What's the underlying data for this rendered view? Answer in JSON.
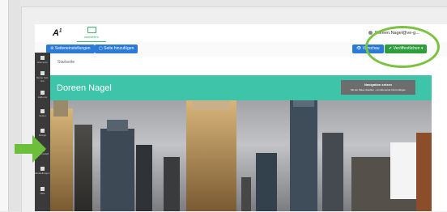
{
  "app": {
    "logo_text": "A",
    "logo_sup": "1",
    "top_nav_label": "webseiten",
    "user_name": "Doreen.Nagel@ve-g..."
  },
  "toolbar": {
    "settings_label": "⚙ Seiteneinstellungen",
    "add_page_label": "▢ Seite hinzufügen",
    "preview_label": "👁 Vorschau",
    "publish_label": "✔ Veröffentlichen ▾"
  },
  "breadcrumb": "Startseite",
  "sidebar": {
    "items": [
      {
        "label": "Elemente",
        "icon": "grid-icon"
      },
      {
        "label": "Meine Sek- tion",
        "icon": "plus-icon"
      },
      {
        "label": "Add-ons",
        "icon": "puzzle-icon"
      },
      {
        "label": "Seiten",
        "icon": "pages-icon"
      },
      {
        "label": "Design",
        "icon": "monitor-icon"
      },
      {
        "label": "Farbmodell",
        "icon": "drop-icon"
      },
      {
        "label": "Einstellungen",
        "icon": "gear-icon"
      },
      {
        "label": "Hilfe",
        "icon": "help-icon"
      }
    ]
  },
  "hero": {
    "title": "Doreen Nagel",
    "nav_box_title": "Navigation setzen",
    "nav_box_subtitle": "Mit der Maus drauflen - um Elemente hinzuzufügen"
  },
  "colors": {
    "accent_teal": "#3ec4a8",
    "primary_blue": "#2b7ad6",
    "publish_green": "#2e9e3d",
    "highlight_green": "#7cc242",
    "arrow_green": "#6bbf3a"
  }
}
